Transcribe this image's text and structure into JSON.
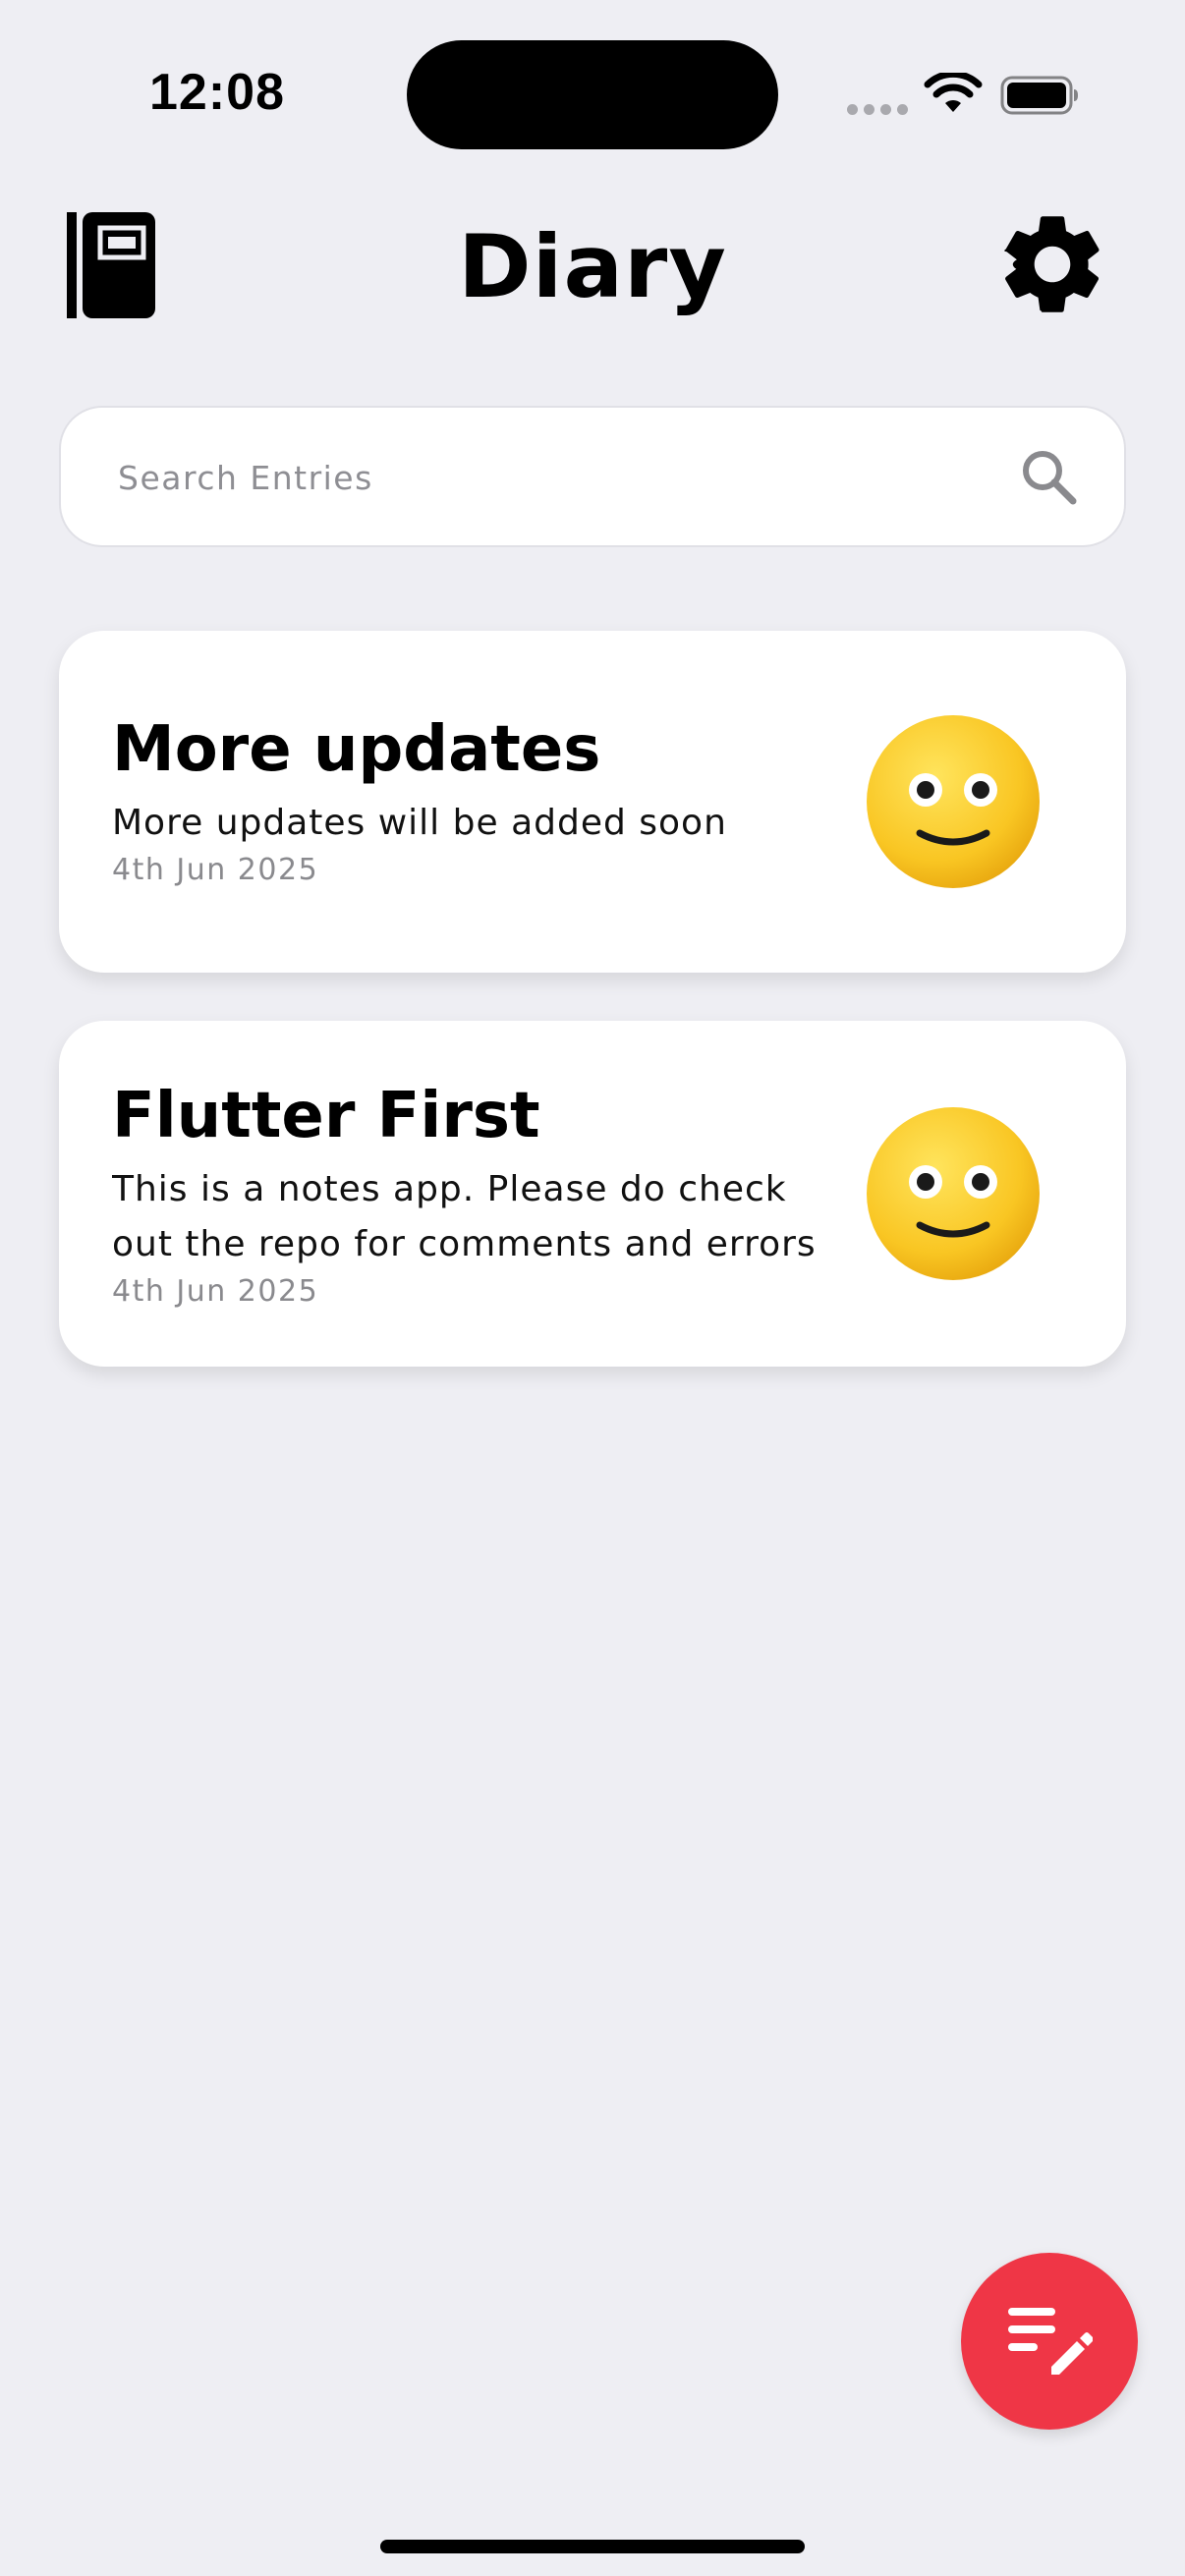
{
  "status_bar": {
    "time": "12:08"
  },
  "header": {
    "title": "Diary",
    "left_icon": "notebook-icon",
    "right_icon": "gear-icon"
  },
  "search": {
    "placeholder": "Search Entries",
    "value": "",
    "icon": "search-icon"
  },
  "entries": [
    {
      "title": "More updates",
      "body": "More updates will be added soon",
      "date": "4th Jun 2025",
      "mood_icon": "slightly-smiling-face-emoji"
    },
    {
      "title": "Flutter First",
      "body": "This is a notes app. Please do check out the repo for comments and errors",
      "date": "4th Jun 2025",
      "mood_icon": "slightly-smiling-face-emoji"
    }
  ],
  "fab": {
    "icon": "edit-note-icon",
    "color": "#EF3646"
  },
  "colors": {
    "background": "#EEEEF3",
    "card": "#FFFFFF",
    "accent": "#EF3646"
  }
}
